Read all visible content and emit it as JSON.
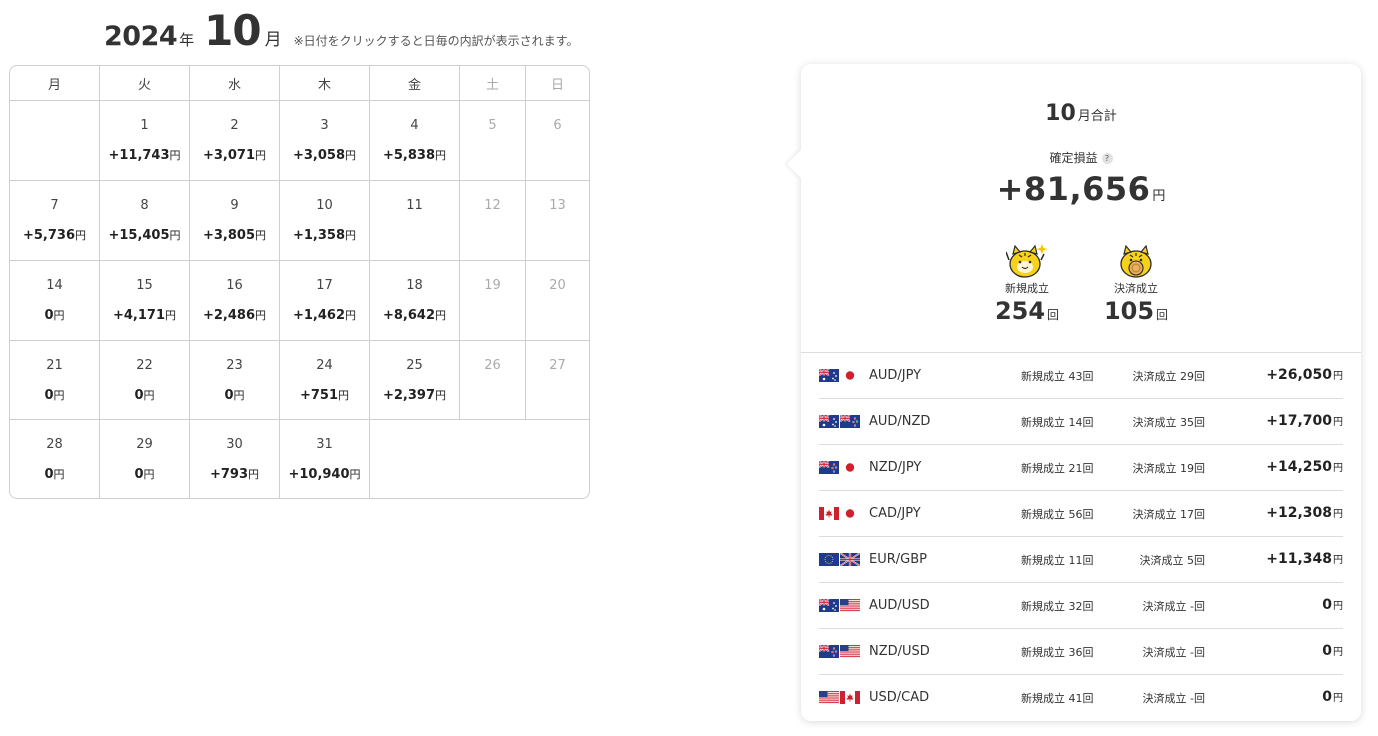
{
  "header": {
    "year": "2024",
    "year_unit": "年",
    "month": "10",
    "month_unit": "月",
    "note": "※日付をクリックすると日毎の内訳が表示されます。"
  },
  "calendar": {
    "weekdays": [
      "月",
      "火",
      "水",
      "木",
      "金",
      "土",
      "日"
    ],
    "yen": "円",
    "weeks": [
      [
        {
          "day": "",
          "value": ""
        },
        {
          "day": "1",
          "value": "+11,743"
        },
        {
          "day": "2",
          "value": "+3,071"
        },
        {
          "day": "3",
          "value": "+3,058"
        },
        {
          "day": "4",
          "value": "+5,838"
        },
        {
          "day": "5",
          "value": ""
        },
        {
          "day": "6",
          "value": ""
        }
      ],
      [
        {
          "day": "7",
          "value": "+5,736"
        },
        {
          "day": "8",
          "value": "+15,405"
        },
        {
          "day": "9",
          "value": "+3,805"
        },
        {
          "day": "10",
          "value": "+1,358"
        },
        {
          "day": "11",
          "value": ""
        },
        {
          "day": "12",
          "value": ""
        },
        {
          "day": "13",
          "value": ""
        }
      ],
      [
        {
          "day": "14",
          "value": "0"
        },
        {
          "day": "15",
          "value": "+4,171"
        },
        {
          "day": "16",
          "value": "+2,486"
        },
        {
          "day": "17",
          "value": "+1,462"
        },
        {
          "day": "18",
          "value": "+8,642"
        },
        {
          "day": "19",
          "value": ""
        },
        {
          "day": "20",
          "value": ""
        }
      ],
      [
        {
          "day": "21",
          "value": "0"
        },
        {
          "day": "22",
          "value": "0"
        },
        {
          "day": "23",
          "value": "0"
        },
        {
          "day": "24",
          "value": "+751"
        },
        {
          "day": "25",
          "value": "+2,397"
        },
        {
          "day": "26",
          "value": ""
        },
        {
          "day": "27",
          "value": ""
        }
      ],
      [
        {
          "day": "28",
          "value": "0"
        },
        {
          "day": "29",
          "value": "0"
        },
        {
          "day": "30",
          "value": "+793"
        },
        {
          "day": "31",
          "value": "+10,940"
        }
      ]
    ]
  },
  "summary": {
    "month": "10",
    "month_label": "月合計",
    "profit_label": "確定損益",
    "help_mark": "?",
    "total": "+81,656",
    "yen": "円",
    "new_label": "新規成立",
    "new_count": "254",
    "settle_label": "決済成立",
    "settle_count": "105",
    "count_unit": "回"
  },
  "pairs": [
    {
      "flags": [
        "flag-au-icon",
        "flag-jp-icon"
      ],
      "name": "AUD/JPY",
      "new": "新規成立 43回",
      "settle": "決済成立 29回",
      "pl": "+26,050"
    },
    {
      "flags": [
        "flag-au-icon",
        "flag-nz-icon"
      ],
      "name": "AUD/NZD",
      "new": "新規成立 14回",
      "settle": "決済成立 35回",
      "pl": "+17,700"
    },
    {
      "flags": [
        "flag-nz-icon",
        "flag-jp-icon"
      ],
      "name": "NZD/JPY",
      "new": "新規成立 21回",
      "settle": "決済成立 19回",
      "pl": "+14,250"
    },
    {
      "flags": [
        "flag-ca-icon",
        "flag-jp-icon"
      ],
      "name": "CAD/JPY",
      "new": "新規成立 56回",
      "settle": "決済成立 17回",
      "pl": "+12,308"
    },
    {
      "flags": [
        "flag-eu-icon",
        "flag-gb-icon"
      ],
      "name": "EUR/GBP",
      "new": "新規成立 11回",
      "settle": "決済成立 5回",
      "pl": "+11,348"
    },
    {
      "flags": [
        "flag-au-icon",
        "flag-us-icon"
      ],
      "name": "AUD/USD",
      "new": "新規成立 32回",
      "settle": "決済成立 -回",
      "pl": "0"
    },
    {
      "flags": [
        "flag-nz-icon",
        "flag-us-icon"
      ],
      "name": "NZD/USD",
      "new": "新規成立 36回",
      "settle": "決済成立 -回",
      "pl": "0"
    },
    {
      "flags": [
        "flag-us-icon",
        "flag-ca-icon"
      ],
      "name": "USD/CAD",
      "new": "新規成立 41回",
      "settle": "決済成立 -回",
      "pl": "0"
    }
  ]
}
